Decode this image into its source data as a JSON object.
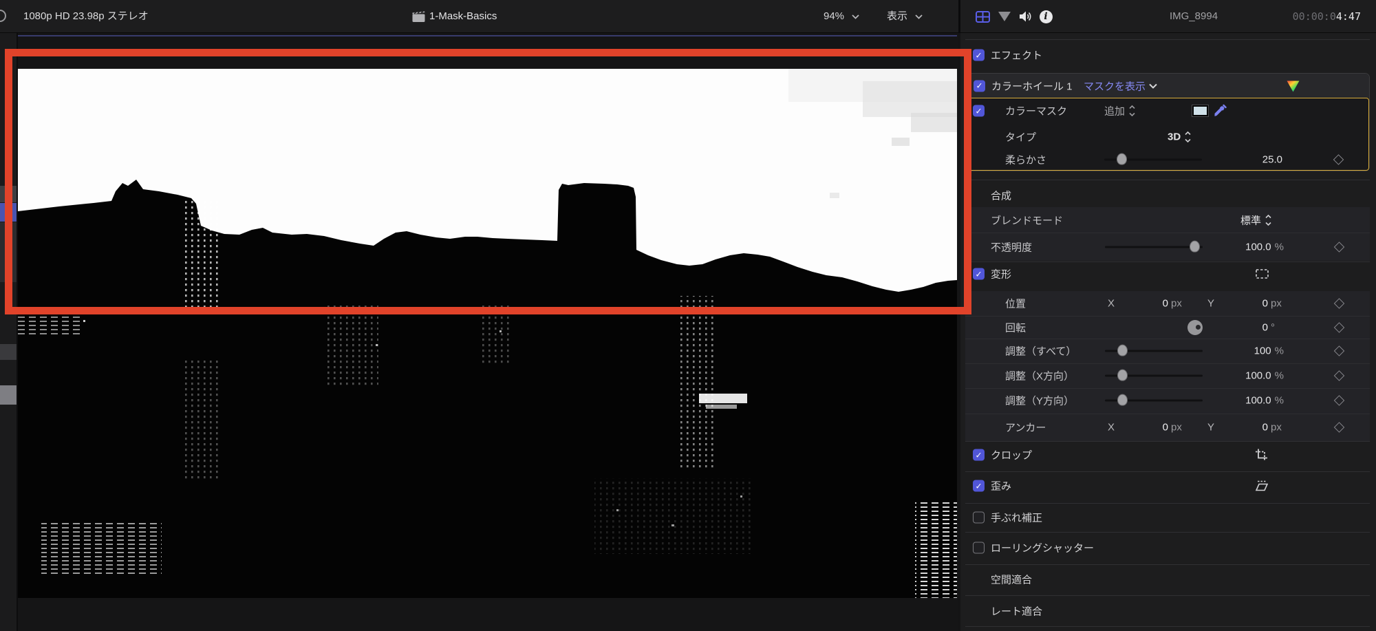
{
  "topbar": {
    "format_label": "1080p HD 23.98p ステレオ",
    "project_title": "1-Mask-Basics",
    "zoom_value": "94%",
    "view_label": "表示"
  },
  "inspector_header": {
    "clip_name": "IMG_8994",
    "timecode_dim": "00:00:0",
    "timecode_bright": "4:47"
  },
  "insp": {
    "effects": "エフェクト",
    "wheels": "カラーホイール 1",
    "mask_view": "マスクを表示",
    "cmask": "カラーマスク",
    "add": "追加",
    "type": "タイプ",
    "type_val": "3D",
    "soft": "柔らかさ",
    "soft_val": "25.0",
    "comp": "合成",
    "blend": "ブレンドモード",
    "blend_val": "標準",
    "opac": "不透明度",
    "opac_val": "100.0",
    "pct": "%",
    "xform": "変形",
    "pos": "位置",
    "x": "X",
    "y": "Y",
    "zero": "0",
    "px": "px",
    "rot": "回転",
    "deg": "°",
    "sall": "調整（すべて）",
    "sall_val": "100",
    "sx": "調整（X方向）",
    "sy": "調整（Y方向）",
    "sxy_val": "100.0",
    "anchor": "アンカー",
    "crop": "クロップ",
    "distort": "歪み",
    "stab": "手ぶれ補正",
    "rolling": "ローリングシャッター",
    "spatial": "空間適合",
    "rate": "レート適合"
  },
  "glyph": {
    "check": "✓"
  },
  "colors": {
    "accent_checkbox": "#5156d8",
    "link_periwinkle": "#8589f2",
    "selection_yellow": "#d8ac3a",
    "annotation_red": "#e1432a",
    "mask_swatch": "#cfe0e8"
  },
  "icons": {
    "magnifier": "search magnifier (clipped at edge)",
    "clapperboard": "project clapperboard",
    "film": "video inspector film frame",
    "mask_triangle": "gray overlay triangle",
    "speaker": "audio speaker",
    "info": "info circle",
    "color_wheels_badge": "rainbow triangle",
    "eyedropper": "color pick eyedropper",
    "transform": "transform dashed frame",
    "crop_icon": "crop corners",
    "distort_icon": "distort parallelogram",
    "rotation_dial": "rotation dial",
    "keyframe": "keyframe diamond"
  }
}
